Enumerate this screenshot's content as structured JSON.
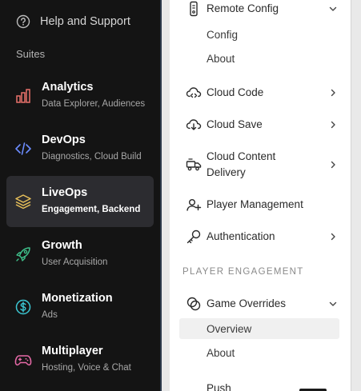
{
  "sidebar": {
    "help_label": "Help and Support",
    "suites_label": "Suites",
    "suites": [
      {
        "title": "Analytics",
        "subtitle": "Data Explorer, Audiences",
        "icon": "bar-chart-icon",
        "color": "#e8716b",
        "active": false
      },
      {
        "title": "DevOps",
        "subtitle": "Diagnostics, Cloud Build",
        "icon": "code-brackets-icon",
        "color": "#6c8cff",
        "active": false
      },
      {
        "title": "LiveOps",
        "subtitle": "Engagement, Backend",
        "icon": "layers-icon",
        "color": "#e8c15a",
        "active": true
      },
      {
        "title": "Growth",
        "subtitle": "User Acquisition",
        "icon": "rocket-icon",
        "color": "#3fbf8a",
        "active": false
      },
      {
        "title": "Monetization",
        "subtitle": "Ads",
        "icon": "dollar-circle-icon",
        "color": "#3cc8d4",
        "active": false
      },
      {
        "title": "Multiplayer",
        "subtitle": "Hosting, Voice & Chat",
        "icon": "gamepad-icon",
        "color": "#e86aa8",
        "active": false
      }
    ]
  },
  "nav": {
    "remote_config": {
      "label": "Remote Config",
      "icon": "phone-config-icon",
      "expanded": true,
      "children": [
        "Config",
        "About"
      ]
    },
    "items": [
      {
        "label": "Cloud Code",
        "icon": "cloud-code-icon",
        "has_chevron": true
      },
      {
        "label": "Cloud Save",
        "icon": "cloud-save-icon",
        "has_chevron": true
      },
      {
        "label": "Cloud Content",
        "label2": "Delivery",
        "icon": "delivery-truck-icon",
        "has_chevron": true
      },
      {
        "label": "Player Management",
        "icon": "user-add-icon",
        "has_chevron": false
      },
      {
        "label": "Authentication",
        "icon": "key-icon",
        "has_chevron": true
      }
    ],
    "section_player_engagement": "PLAYER ENGAGEMENT",
    "game_overrides": {
      "label": "Game Overrides",
      "icon": "overrides-icon",
      "expanded": true,
      "children": [
        "Overview",
        "About"
      ],
      "selected": "Overview"
    },
    "push_label": "Push"
  }
}
